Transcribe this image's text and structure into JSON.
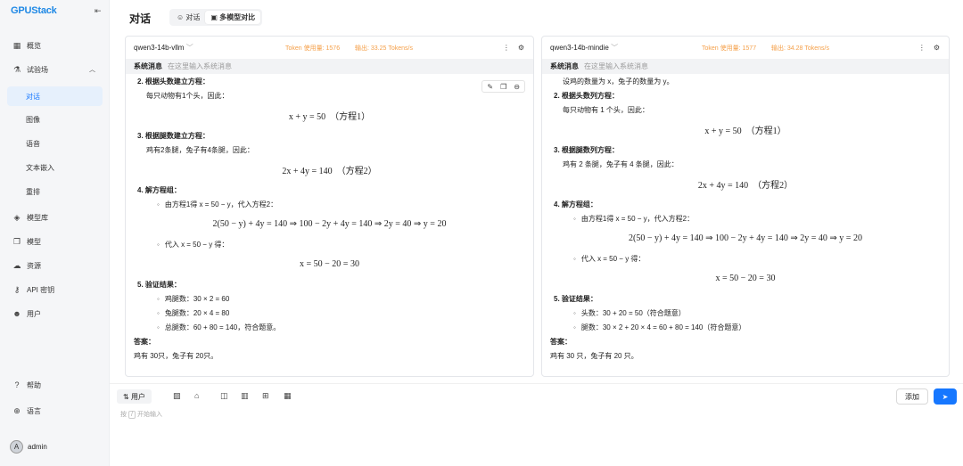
{
  "app": {
    "logo": "GPUStack",
    "page_title": "对话",
    "user": "admin",
    "avatar_letter": "A"
  },
  "sidebar": {
    "items": [
      {
        "label": "概览",
        "icon": "grid-icon"
      },
      {
        "label": "试验场",
        "icon": "flask-icon",
        "expanded": true
      },
      {
        "label": "对话",
        "sub": true,
        "active": true
      },
      {
        "label": "图像",
        "sub": true
      },
      {
        "label": "语音",
        "sub": true
      },
      {
        "label": "文本嵌入",
        "sub": true
      },
      {
        "label": "重排",
        "sub": true
      },
      {
        "label": "模型库",
        "icon": "layers-icon"
      },
      {
        "label": "模型",
        "icon": "copy-icon"
      },
      {
        "label": "资源",
        "icon": "cloud-icon"
      },
      {
        "label": "API 密钥",
        "icon": "key-icon"
      },
      {
        "label": "用户",
        "icon": "users-icon"
      }
    ],
    "bottom": [
      {
        "label": "帮助",
        "icon": "help-icon"
      },
      {
        "label": "语言",
        "icon": "globe-icon"
      }
    ]
  },
  "tabs": [
    {
      "label": "对话",
      "icon": "chat-icon"
    },
    {
      "label": "多模型对比",
      "icon": "compare-icon",
      "active": true
    }
  ],
  "panels": [
    {
      "model": "qwen3-14b-vllm",
      "token": "Token 使用量: 1576",
      "speed": "输出: 33.25 Tokens/s",
      "system_label": "系统消息",
      "system_placeholder": "在这里输入系统消息",
      "lines": [
        {
          "k": "h",
          "v": "2. 根据头数建立方程："
        },
        {
          "k": "t",
          "v": "每只动物有1个头，因此："
        },
        {
          "k": "f",
          "v": "x + y = 50　（方程1）"
        },
        {
          "k": "h",
          "v": "3. 根据腿数建立方程："
        },
        {
          "k": "t",
          "v": "鸡有2条腿，兔子有4条腿，因此："
        },
        {
          "k": "f",
          "v": "2x + 4y = 140　（方程2）"
        },
        {
          "k": "h",
          "v": "4. 解方程组："
        },
        {
          "k": "b",
          "v": "由方程1得 x = 50 − y，代入方程2："
        },
        {
          "k": "f",
          "v": "2(50 − y) + 4y = 140 ⇒ 100 − 2y + 4y = 140 ⇒ 2y = 40 ⇒ y = 20"
        },
        {
          "k": "b",
          "v": "代入 x = 50 − y 得："
        },
        {
          "k": "f",
          "v": "x = 50 − 20 = 30"
        },
        {
          "k": "h",
          "v": "5. 验证结果："
        },
        {
          "k": "b",
          "v": "鸡腿数：30 × 2 = 60"
        },
        {
          "k": "b",
          "v": "兔腿数：20 × 4 = 80"
        },
        {
          "k": "b",
          "v": "总腿数：60 + 80 = 140，符合题意。"
        },
        {
          "k": "ah",
          "v": "答案："
        },
        {
          "k": "a",
          "v": "鸡有 30只，兔子有 20只。"
        }
      ]
    },
    {
      "model": "qwen3-14b-mindie",
      "token": "Token 使用量: 1577",
      "speed": "输出: 34.28 Tokens/s",
      "system_label": "系统消息",
      "system_placeholder": "在这里输入系统消息",
      "lines": [
        {
          "k": "t",
          "v": "设鸡的数量为 x，兔子的数量为 y。"
        },
        {
          "k": "h",
          "v": "2. 根据头数列方程："
        },
        {
          "k": "t",
          "v": "每只动物有 1 个头，因此："
        },
        {
          "k": "f",
          "v": "x + y = 50　（方程1）"
        },
        {
          "k": "h",
          "v": "3. 根据腿数列方程："
        },
        {
          "k": "t",
          "v": "鸡有 2 条腿，兔子有 4 条腿，因此："
        },
        {
          "k": "f",
          "v": "2x + 4y = 140　（方程2）"
        },
        {
          "k": "h",
          "v": "4. 解方程组："
        },
        {
          "k": "b",
          "v": "由方程1得 x = 50 − y，代入方程2："
        },
        {
          "k": "f",
          "v": "2(50 − y) + 4y = 140 ⇒ 100 − 2y + 4y = 140 ⇒ 2y = 40 ⇒ y = 20"
        },
        {
          "k": "b",
          "v": "代入 x = 50 − y 得："
        },
        {
          "k": "f",
          "v": "x = 50 − 20 = 30"
        },
        {
          "k": "h",
          "v": "5. 验证结果："
        },
        {
          "k": "b",
          "v": "头数：30 + 20 = 50（符合题意）"
        },
        {
          "k": "b",
          "v": "腿数：30 × 2 + 20 × 4 = 60 + 80 = 140（符合题意）"
        },
        {
          "k": "ah",
          "v": "答案："
        },
        {
          "k": "a",
          "v": "鸡有 30 只，兔子有 20 只。"
        }
      ]
    }
  ],
  "composer": {
    "role": "用户",
    "hint_pre": "按",
    "hint_key": "/",
    "hint_post": "开始输入",
    "add": "添加"
  },
  "colors": {
    "accent": "#1677ff",
    "stat": "#f5a04a"
  }
}
